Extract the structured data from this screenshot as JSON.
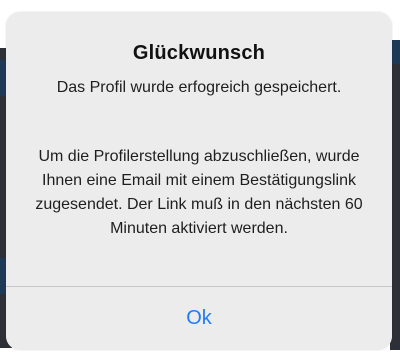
{
  "alert": {
    "title": "Glückwunsch",
    "message": "Das Profil wurde erfogreich gespeichert.",
    "details": "Um die Profilerstellung abzuschließen, wurde Ihnen eine Email mit einem Bestätigungslink zugesendet. Der Link muß in den nächsten 60 Minuten aktiviert werden.",
    "ok_label": "Ok"
  },
  "colors": {
    "accent": "#1f7cf5",
    "alert_background": "#ececec",
    "backdrop_dark": "#2d3137"
  }
}
